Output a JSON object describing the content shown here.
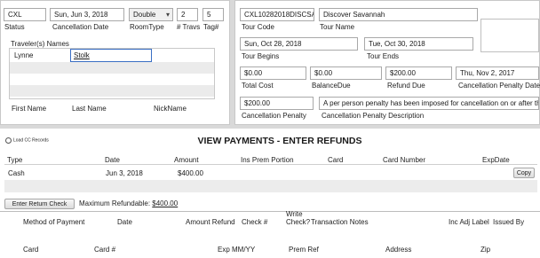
{
  "header": {
    "status_value": "CXL",
    "status_label": "Status",
    "cancel_date_value": "Sun, Jun 3, 2018",
    "cancel_date_label": "Cancellation Date",
    "room_type_value": "Double",
    "room_type_label": "RoomType",
    "travs_value": "2",
    "travs_label": "# Travs",
    "tag_value": "5",
    "tag_label": "Tag#"
  },
  "travelers": {
    "group_label": "Traveler(s) Names",
    "first_name": "Lynne",
    "last_name": "Stolk",
    "col_first": "First Name",
    "col_last": "Last Name",
    "col_nick": "NickName"
  },
  "tour": {
    "code_value": "CXL10282018DISCSAV",
    "code_label": "Tour Code",
    "name_value": "Discover Savannah",
    "name_label": "Tour Name",
    "begins_value": "Sun, Oct 28, 2018",
    "begins_label": "Tour Begins",
    "ends_value": "Tue, Oct 30, 2018",
    "ends_label": "Tour Ends",
    "total_cost_value": "$0.00",
    "total_cost_label": "Total Cost",
    "balance_value": "$0.00",
    "balance_label": "BalanceDue",
    "refund_value": "$200.00",
    "refund_label": "Refund Due",
    "penalty_date_value": "Thu, Nov 2, 2017",
    "penalty_date_label": "Cancellation Penalty Date",
    "penalty_value": "$200.00",
    "penalty_label": "Cancellation Penalty",
    "penalty_desc_value": "A per person penalty has been imposed for cancellation on or after the",
    "penalty_desc_label": "Cancellation Penalty Description"
  },
  "payments": {
    "load_cc_label": "Load CC Records",
    "title": "VIEW PAYMENTS - ENTER REFUNDS",
    "columns": [
      "Type",
      "Date",
      "Amount",
      "Ins Prem Portion",
      "Card",
      "Card Number",
      "ExpDate"
    ],
    "rows": [
      {
        "type": "Cash",
        "date": "Jun 3, 2018",
        "amount": "$400.00"
      }
    ],
    "copy_label": "Copy"
  },
  "refunds": {
    "enter_button": "Enter Return Check",
    "max_label": "Maximum Refundable:",
    "max_value": "$400.00",
    "columns": {
      "method": "Method of Payment",
      "date": "Date",
      "amount_refund": "Amount Refund",
      "check_no": "Check #",
      "write_check_1": "Write",
      "write_check_2": "Check?",
      "notes": "Transaction Notes",
      "inc_adj": "Inc Adj Label",
      "issued_by": "Issued By"
    },
    "card_columns": {
      "card": "Card",
      "card_no": "Card #",
      "exp": "Exp MM/YY",
      "prem_ref": "Prem Ref",
      "address": "Address",
      "zip": "Zip"
    }
  }
}
